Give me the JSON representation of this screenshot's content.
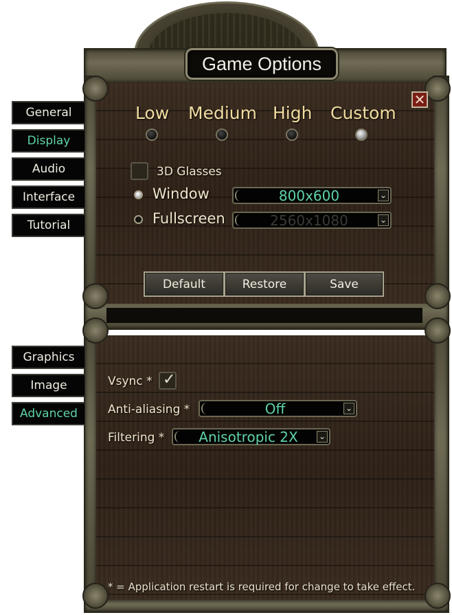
{
  "window": {
    "title": "Game Options",
    "close_glyph": "✕"
  },
  "top_tabs": [
    {
      "label": "General",
      "active": false
    },
    {
      "label": "Display",
      "active": true
    },
    {
      "label": "Audio",
      "active": false
    },
    {
      "label": "Interface",
      "active": false
    },
    {
      "label": "Tutorial",
      "active": false
    }
  ],
  "presets": {
    "options": [
      "Low",
      "Medium",
      "High",
      "Custom"
    ],
    "selected": "Custom"
  },
  "display": {
    "glasses_label": "3D Glasses",
    "glasses_checked": false,
    "window_label": "Window",
    "window_selected": true,
    "window_resolution": "800x600",
    "fullscreen_label": "Fullscreen",
    "fullscreen_selected": false,
    "fullscreen_resolution": "2560x1080"
  },
  "buttons": {
    "default": "Default",
    "restore": "Restore",
    "save": "Save"
  },
  "bottom_tabs": [
    {
      "label": "Graphics",
      "active": false
    },
    {
      "label": "Image",
      "active": false
    },
    {
      "label": "Advanced",
      "active": true
    }
  ],
  "advanced": {
    "vsync_label": "Vsync *",
    "vsync_checked": true,
    "aa_label": "Anti-aliasing *",
    "aa_value": "Off",
    "filtering_label": "Filtering *",
    "filtering_value": "Anisotropic 2X"
  },
  "footnote": "* = Application restart is required for change to take effect.",
  "colors": {
    "accent": "#5fd4a8",
    "preset_text": "#f0dca0",
    "wood": "#2e2218"
  },
  "icons": {
    "close": "close-icon",
    "dropdown": "chevron-down-icon",
    "check": "checkmark-icon"
  }
}
